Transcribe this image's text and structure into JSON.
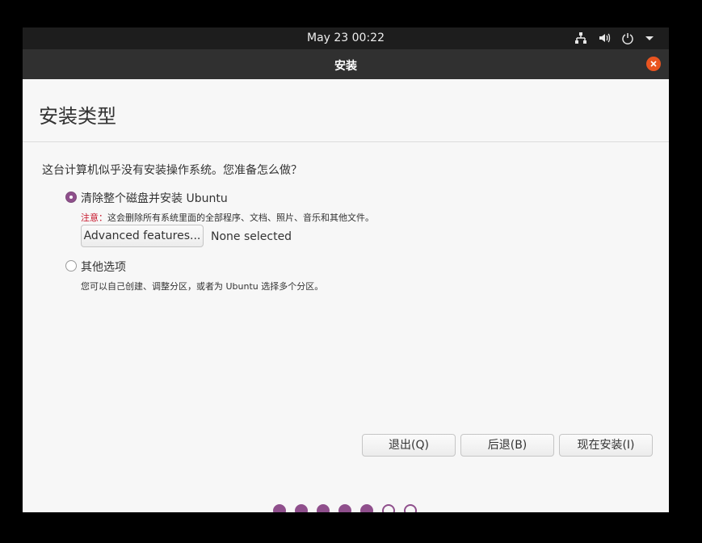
{
  "topbar": {
    "clock": "May 23  00:22",
    "icons": [
      "network-icon",
      "volume-icon",
      "power-icon",
      "dropdown-arrow-icon"
    ]
  },
  "window": {
    "title": "安装"
  },
  "page": {
    "heading": "安装类型",
    "question": "这台计算机似乎没有安装操作系统。您准备怎么做？"
  },
  "options": {
    "erase": {
      "label": "清除整个磁盘并安装 Ubuntu",
      "selected": true,
      "warning_prefix": "注意：",
      "warning_text": "这会删除所有系统里面的全部程序、文档、照片、音乐和其他文件。",
      "advanced_button": "Advanced features...",
      "advanced_status": "None selected"
    },
    "other": {
      "label": "其他选项",
      "selected": false,
      "description": "您可以自己创建、调整分区，或者为 Ubuntu 选择多个分区。"
    }
  },
  "buttons": {
    "quit": "退出(Q)",
    "back": "后退(B)",
    "install_now": "现在安装(I)"
  },
  "progress": {
    "current_step": 5,
    "total_steps": 7
  },
  "colors": {
    "accent": "#8f4f8c",
    "close": "#e95420",
    "warning": "#c7162b"
  }
}
